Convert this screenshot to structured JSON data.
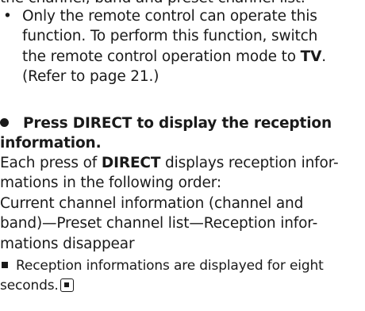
{
  "lines": {
    "clipped_top": "the channel, band and preset channel list.",
    "bullet1_line1": "Only the remote control can operate this",
    "bullet1_line2": "function. To perform this function, switch",
    "bullet1_line3_pre": "the remote control operation mode to ",
    "bullet1_line3_bold": "TV",
    "bullet1_line3_post": ".",
    "bullet1_line4": "(Refer to page 21.)",
    "heading_line1": "Press DIRECT to display the reception",
    "heading_line2": "information.",
    "p1_pre": "Each press of ",
    "p1_bold": "DIRECT",
    "p1_post": " displays reception infor-",
    "p2": "mations in the following order:",
    "p3": "Current channel information (channel and",
    "p4": "band)—Preset channel list—Reception infor-",
    "p5": "mations disappear",
    "note_line1": "Reception informations are displayed for eight",
    "note_line2": "seconds."
  },
  "icons": {
    "bullet": "bullet-dot",
    "heading_marker": "filled-circle-icon",
    "note_marker": "small-square-icon",
    "end_marker": "end-of-section-icon"
  }
}
